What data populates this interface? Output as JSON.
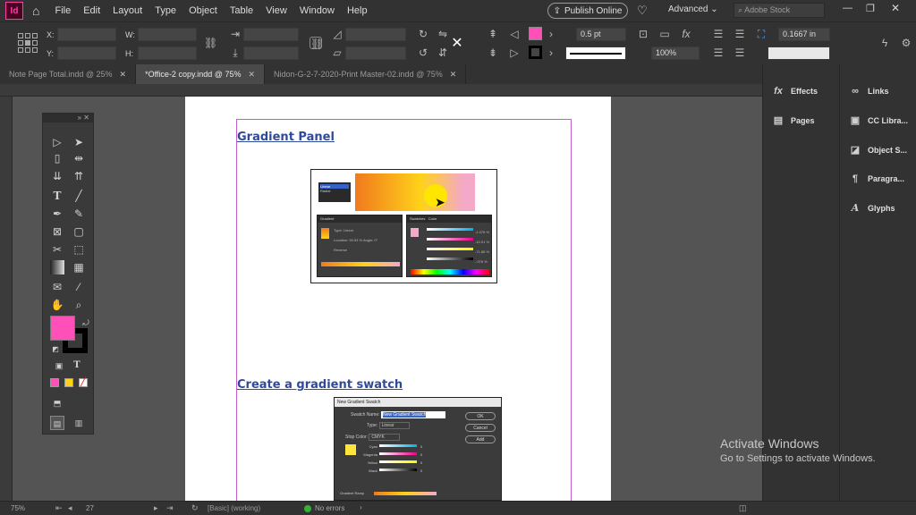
{
  "app": {
    "logo": "Id"
  },
  "menu": {
    "items": [
      "File",
      "Edit",
      "Layout",
      "Type",
      "Object",
      "Table",
      "View",
      "Window",
      "Help"
    ],
    "publish_label": "Publish Online",
    "workspace_label": "Advanced",
    "search_placeholder": "Adobe Stock"
  },
  "control": {
    "x_label": "X:",
    "y_label": "Y:",
    "w_label": "W:",
    "h_label": "H:",
    "stroke_weight": "0.5 pt",
    "zoom": "100%",
    "offset_value": "0.1667 in",
    "fill_color": "#ff4fb8"
  },
  "tabs": [
    {
      "label": "Note Page  Total.indd @ 25%",
      "active": false
    },
    {
      "label": "*Office-2 copy.indd @ 75%",
      "active": true
    },
    {
      "label": "Nidon-G-2-7-2020-Print Master-02.indd @ 75%",
      "active": false
    }
  ],
  "document": {
    "heading1": "Gradient Panel",
    "heading2": "Create a gradient swatch",
    "fig1": {
      "gradient_tab": "Gradient",
      "type_label": "Type:",
      "type_value": "Linear",
      "location_label": "Location:",
      "location_value": "90.53 %",
      "angle_label": "Angle:",
      "angle_value": "0°",
      "reverse_label": "Reverse",
      "swatches_tab": "Swatches",
      "color_tab": "Color",
      "menu_items": [
        "Linear",
        "Radial"
      ],
      "cmyk_values": [
        "-1.076 %",
        "-10.01 %",
        "-71.85 %",
        "-.076 %"
      ]
    },
    "fig2": {
      "title": "New Gradient Swatch",
      "name_label": "Swatch Name:",
      "name_value": "New Gradient Swatch",
      "type_label": "Type:",
      "type_value": "Linear",
      "stop_label": "Stop Color:",
      "stop_value": "CMYK",
      "channels": [
        "Cyan",
        "Magenta",
        "Yellow",
        "Black"
      ],
      "channel_values": [
        "0",
        "0",
        "0",
        "0"
      ],
      "ramp_label": "Gradient Ramp",
      "ok": "OK",
      "cancel": "Cancel",
      "add": "Add"
    }
  },
  "panels": {
    "left": [
      {
        "icon": "fx",
        "label": "Effects"
      },
      {
        "icon": "▤",
        "label": "Pages"
      }
    ],
    "right": [
      {
        "icon": "∞",
        "label": "Links"
      },
      {
        "icon": "▣",
        "label": "CC Libra..."
      },
      {
        "icon": "◪",
        "label": "Object S..."
      },
      {
        "icon": "¶",
        "label": "Paragra..."
      },
      {
        "icon": "A",
        "label": "Glyphs"
      }
    ]
  },
  "tools": {
    "fill_color": "#ff4fb8",
    "stroke_color": "#000000"
  },
  "status": {
    "zoom": "75%",
    "page": "27",
    "profile": "[Basic] (working)",
    "errors": "No errors"
  },
  "watermark": {
    "title": "Activate Windows",
    "subtitle": "Go to Settings to activate Windows."
  }
}
